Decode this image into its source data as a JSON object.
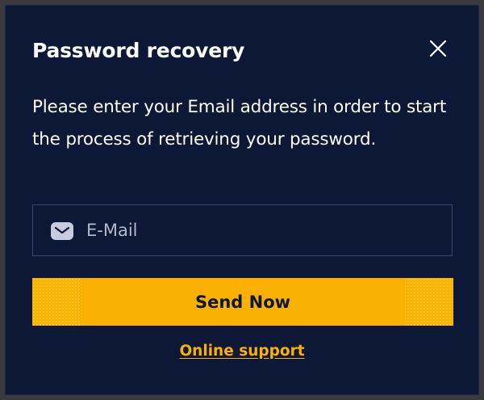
{
  "dialog": {
    "title": "Password recovery",
    "description": "Please enter your Email address in order to start the process of retrieving your password.",
    "close_icon": "close-icon"
  },
  "email": {
    "placeholder": "E-Mail",
    "value": "",
    "icon": "mail-icon"
  },
  "send_button": {
    "label": "Send Now"
  },
  "support_link": {
    "label": "Online support"
  },
  "colors": {
    "background": "#0d1736",
    "accent": "#fbb104",
    "text": "#ffffff",
    "field_border": "#3a4568"
  }
}
